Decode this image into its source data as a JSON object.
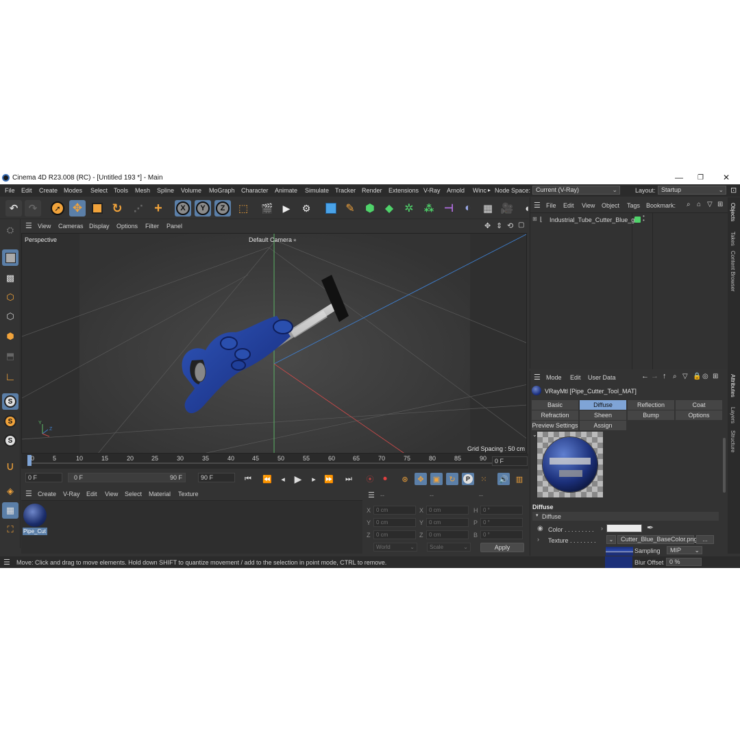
{
  "window": {
    "title": "Cinema 4D R23.008 (RC) - [Untitled 193 *] - Main",
    "minimize": "—",
    "maximize": "❐",
    "close": "✕"
  },
  "menu": {
    "items": [
      "File",
      "Edit",
      "Create",
      "Modes",
      "Select",
      "Tools",
      "Mesh",
      "Spline",
      "Volume",
      "MoGraph",
      "Character",
      "Animate",
      "Simulate",
      "Tracker",
      "Render",
      "Extensions",
      "V-Ray",
      "Arnold",
      "Winc"
    ],
    "node_space_label": "Node Space:",
    "node_space_value": "Current (V-Ray)",
    "layout_label": "Layout:",
    "layout_value": "Startup"
  },
  "viewport": {
    "menu": [
      "View",
      "Cameras",
      "Display",
      "Options",
      "Filter",
      "Panel"
    ],
    "name": "Perspective",
    "camera": "Default Camera",
    "camera_icon": "⁎",
    "grid_spacing": "Grid Spacing : 50 cm",
    "axis_y": "Y",
    "axis_z": "Z"
  },
  "timeline": {
    "ticks": [
      "0",
      "5",
      "10",
      "15",
      "20",
      "25",
      "30",
      "35",
      "40",
      "45",
      "50",
      "55",
      "60",
      "65",
      "70",
      "75",
      "80",
      "85",
      "90"
    ],
    "current_frame": "0 F",
    "start_field": "0 F",
    "range_start": "0 F",
    "range_end": "90 F",
    "end_field": "90 F"
  },
  "material_manager": {
    "menu": [
      "Create",
      "V-Ray",
      "Edit",
      "View",
      "Select",
      "Material",
      "Texture"
    ],
    "material_label": "Pipe_Cut"
  },
  "coordinates": {
    "headers": [
      "--",
      "--",
      "--"
    ],
    "rows": [
      {
        "a": "X",
        "av": "0 cm",
        "b": "X",
        "bv": "0 cm",
        "c": "H",
        "cv": "0 °"
      },
      {
        "a": "Y",
        "av": "0 cm",
        "b": "Y",
        "bv": "0 cm",
        "c": "P",
        "cv": "0 °"
      },
      {
        "a": "Z",
        "av": "0 cm",
        "b": "Z",
        "bv": "0 cm",
        "c": "B",
        "cv": "0 °"
      }
    ],
    "world": "World",
    "scale": "Scale",
    "apply": "Apply"
  },
  "status": "Move: Click and drag to move elements. Hold down SHIFT to quantize movement / add to the selection in point mode, CTRL to remove.",
  "object_manager": {
    "menu": [
      "File",
      "Edit",
      "View",
      "Object",
      "Tags",
      "Bookmark:"
    ],
    "object_name": "Industrial_Tube_Cutter_Blue_g"
  },
  "attributes": {
    "menu": [
      "Mode",
      "Edit",
      "User Data"
    ],
    "material_title": "VRayMtl [Pipe_Cutter_Tool_MAT]",
    "tabs_row1": [
      "Basic",
      "Diffuse",
      "Reflection",
      "Coat"
    ],
    "tabs_row2": [
      "Refraction",
      "Sheen",
      "Bump",
      "Options"
    ],
    "tabs_row3": [
      "Preview Settings",
      "Assign"
    ],
    "section": "Diffuse",
    "group": "Diffuse",
    "color_label": "Color . . . . . . . . .",
    "texture_label": "Texture . . . . . . . .",
    "texture_file": "Cutter_Blue_BaseColor.png",
    "more": "...",
    "sampling_label": "Sampling",
    "sampling_value": "MIP",
    "blur_label": "Blur Offset",
    "blur_value": "0 %"
  },
  "side_tabs": [
    "Objects",
    "Takes",
    "Content Browser",
    "Attributes",
    "Layers",
    "Structure"
  ],
  "colors": {
    "accent_selected": "#5b7fa8",
    "tab_active": "#7fa4d6",
    "tool_blue": "#1e3f8f"
  }
}
